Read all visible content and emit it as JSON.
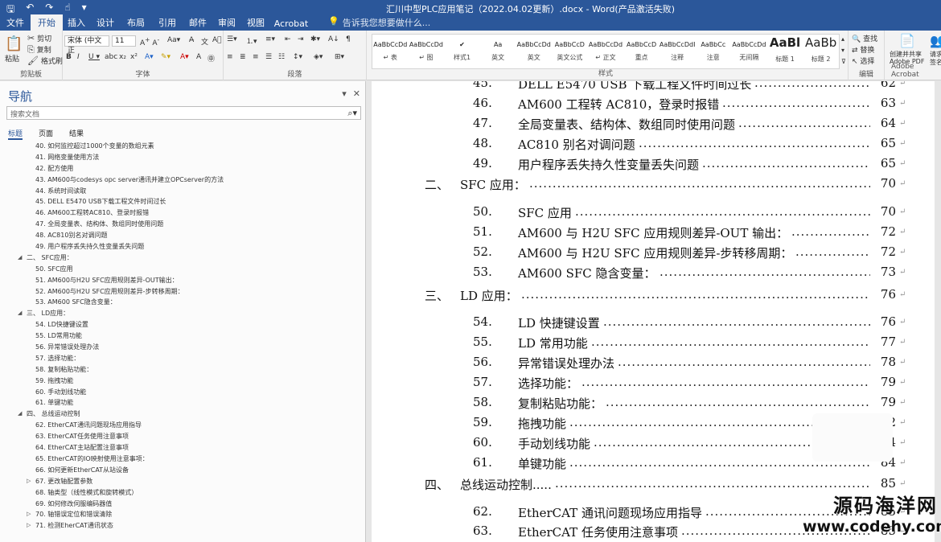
{
  "titlebar": {
    "title": "汇川中型PLC应用笔记（2022.04.02更新）.docx - Word(产品激活失败)",
    "icons": [
      "save-icon",
      "undo-icon",
      "redo-icon",
      "touch-mode-icon",
      "customize-icon"
    ]
  },
  "tabs": [
    {
      "label": "文件"
    },
    {
      "label": "开始"
    },
    {
      "label": "插入"
    },
    {
      "label": "设计"
    },
    {
      "label": "布局"
    },
    {
      "label": "引用"
    },
    {
      "label": "邮件"
    },
    {
      "label": "审阅"
    },
    {
      "label": "视图"
    },
    {
      "label": "Acrobat"
    }
  ],
  "tell_me": "告诉我您想要做什么...",
  "ribbon": {
    "clipboard": {
      "label": "剪贴板",
      "paste": "粘贴",
      "cut": "剪切",
      "copy": "复制",
      "format_painter": "格式刷"
    },
    "font": {
      "label": "字体",
      "name": "宋体 (中文正",
      "size": "11"
    },
    "paragraph": {
      "label": "段落"
    },
    "styles": {
      "label": "样式",
      "items": [
        {
          "sample": "AaBbCcDd",
          "name": "↵ 表"
        },
        {
          "sample": "AaBbCcDd",
          "name": "↵ 图"
        },
        {
          "sample": "✔",
          "name": "样式1"
        },
        {
          "sample": "Aa",
          "name": "英文"
        },
        {
          "sample": "AaBbCcDd",
          "name": "英文"
        },
        {
          "sample": "AaBbCcD",
          "name": "英文公式"
        },
        {
          "sample": "AaBbCcDd",
          "name": "↵ 正文"
        },
        {
          "sample": "AaBbCcD",
          "name": "重点"
        },
        {
          "sample": "AaBbCcDdI",
          "name": "注释"
        },
        {
          "sample": "AaBbCc",
          "name": "注意"
        },
        {
          "sample": "AaBbCcDd",
          "name": "无间隔"
        },
        {
          "sample": "AaBl",
          "name": "标题 1"
        },
        {
          "sample": "AaBb",
          "name": "标题 2"
        }
      ]
    },
    "editing": {
      "label": "编辑",
      "find": "查找",
      "replace": "替换",
      "select": "选择"
    },
    "acrobat": {
      "label": "Adobe Acrobat",
      "create": "创建并共享",
      "create2": "Adobe PDF",
      "request": "请求",
      "request2": "签名"
    }
  },
  "nav": {
    "title": "导航",
    "search_placeholder": "搜索文档",
    "tabs": [
      "标题",
      "页面",
      "结果"
    ],
    "items": [
      {
        "text": "40. 如何监控超过1000个变量的数组元素",
        "level": 2
      },
      {
        "text": "41. 网络变量使用方法",
        "level": 2
      },
      {
        "text": "42. 配方使用",
        "level": 2
      },
      {
        "text": "43. AM600与codesys opc server通讯并建立OPCserver的方法",
        "level": 2
      },
      {
        "text": "44. 系统时间读取",
        "level": 2
      },
      {
        "text": "45. DELL E5470  USB下载工程文件时间过长",
        "level": 2
      },
      {
        "text": "46. AM600工程转AC810、登录时报错",
        "level": 2
      },
      {
        "text": "47. 全局变量表、结构体、数组同时使用问题",
        "level": 2
      },
      {
        "text": "48. AC810别名对调问题",
        "level": 2
      },
      {
        "text": "49. 用户程序丢失持久性变量丢失问题",
        "level": 2
      },
      {
        "text": "二、  SFC应用：",
        "level": 1,
        "arrow": "◢"
      },
      {
        "text": "50. SFC应用",
        "level": 2
      },
      {
        "text": "51. AM600与H2U SFC应用规则差异-OUT输出：",
        "level": 2
      },
      {
        "text": "52. AM600与H2U SFC应用规则差异-步转移周期：",
        "level": 2
      },
      {
        "text": "53. AM600 SFC隐含变量：",
        "level": 2
      },
      {
        "text": "三、  LD应用：",
        "level": 1,
        "arrow": "◢"
      },
      {
        "text": "54. LD快捷键设置",
        "level": 2
      },
      {
        "text": "55. LD常用功能",
        "level": 2
      },
      {
        "text": "56. 异常错误处理办法",
        "level": 2
      },
      {
        "text": "57. 选择功能：",
        "level": 2
      },
      {
        "text": "58. 复制粘贴功能：",
        "level": 2
      },
      {
        "text": "59. 拖拽功能",
        "level": 2
      },
      {
        "text": "60. 手动划线功能",
        "level": 2
      },
      {
        "text": "61. 单键功能",
        "level": 2
      },
      {
        "text": "四、  总线运动控制",
        "level": 1,
        "arrow": "◢"
      },
      {
        "text": "62. EtherCAT通讯问题现场应用指导",
        "level": 2
      },
      {
        "text": "63. EtherCAT任务使用注意事项",
        "level": 2
      },
      {
        "text": "64. EtherCAT主站配置注意事项",
        "level": 2
      },
      {
        "text": "65. EtherCAT的IO映射使用注意事项：",
        "level": 2
      },
      {
        "text": "66. 如何更新EtherCAT从站设备",
        "level": 2
      },
      {
        "text": "67. 更改轴配置参数",
        "level": 2,
        "arrow": "▷"
      },
      {
        "text": "68. 轴类型（线性模式和旋转模式）",
        "level": 2
      },
      {
        "text": "69. 如何修改伺服编码器值",
        "level": 2
      },
      {
        "text": "70. 轴错误定位和错误清除",
        "level": 2,
        "arrow": "▷"
      },
      {
        "text": "71. 检测EherCAT通讯状态",
        "level": 2,
        "arrow": "▷"
      }
    ]
  },
  "document": {
    "entries": [
      {
        "num": "45.",
        "text": "DELL E5470  USB 下载工程文件时间过长",
        "page": "62",
        "level": 2,
        "partial": true
      },
      {
        "num": "46.",
        "text": "AM600 工程转 AC810，登录时报错",
        "page": "63",
        "level": 2
      },
      {
        "num": "47.",
        "text": "全局变量表、结构体、数组同时使用问题",
        "page": "64",
        "level": 2
      },
      {
        "num": "48.",
        "text": "AC810 别名对调问题",
        "page": "65",
        "level": 2
      },
      {
        "num": "49.",
        "text": "用户程序丢失持久性变量丢失问题",
        "page": "65",
        "level": 2
      },
      {
        "num": "二、",
        "text": "SFC 应用：",
        "page": "70",
        "level": 1
      },
      {
        "num": "50.",
        "text": "SFC 应用",
        "page": "70",
        "level": 2
      },
      {
        "num": "51.",
        "text": "AM600 与 H2U SFC 应用规则差异-OUT 输出：",
        "page": "72",
        "level": 2
      },
      {
        "num": "52.",
        "text": "AM600 与 H2U SFC 应用规则差异-步转移周期：",
        "page": "72",
        "level": 2
      },
      {
        "num": "53.",
        "text": "AM600 SFC 隐含变量：",
        "page": "73",
        "level": 2
      },
      {
        "num": "三、",
        "text": "LD 应用：",
        "page": "76",
        "level": 1
      },
      {
        "num": "54.",
        "text": "LD 快捷键设置",
        "page": "76",
        "level": 2
      },
      {
        "num": "55.",
        "text": "LD 常用功能",
        "page": "77",
        "level": 2
      },
      {
        "num": "56.",
        "text": "异常错误处理办法",
        "page": "78",
        "level": 2
      },
      {
        "num": "57.",
        "text": "选择功能：",
        "page": "79",
        "level": 2
      },
      {
        "num": "58.",
        "text": "复制粘贴功能：",
        "page": "79",
        "level": 2
      },
      {
        "num": "59.",
        "text": "拖拽功能",
        "page": "82",
        "level": 2
      },
      {
        "num": "60.",
        "text": "手动划线功能",
        "page": "84",
        "level": 2
      },
      {
        "num": "61.",
        "text": "单键功能",
        "page": "84",
        "level": 2
      },
      {
        "num": "四、",
        "text": "总线运动控制.....",
        "page": "85",
        "level": 1
      },
      {
        "num": "62.",
        "text": "EtherCAT 通讯问题现场应用指导",
        "page": "85",
        "level": 2
      },
      {
        "num": "63.",
        "text": "EtherCAT 任务使用注意事项",
        "page": "85",
        "level": 2,
        "partial": true
      }
    ]
  },
  "watermark": {
    "line1": "源码海洋网",
    "line2": "www.codehy.com"
  }
}
